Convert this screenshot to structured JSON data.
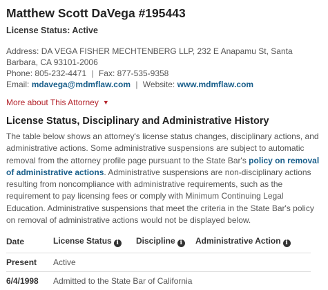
{
  "attorney": {
    "name": "Matthew Scott DaVega #195443",
    "license_status": "License Status: Active"
  },
  "contact": {
    "address_label": "Address:",
    "address_value": "DA VEGA FISHER MECHTENBERG LLP, 232 E Anapamu St, Santa Barbara, CA 93101-2006",
    "phone_label": "Phone:",
    "phone_value": "805-232-4471",
    "separator": "|",
    "fax_label": "Fax:",
    "fax_value": "877-535-9358",
    "email_label": "Email:",
    "email_value": "mdavega@mdmflaw.com",
    "website_label": "Website:",
    "website_value": "www.mdmflaw.com"
  },
  "more_about": {
    "label": "More about This Attorney",
    "icon": "caret-down-icon"
  },
  "history": {
    "title": "License Status, Disciplinary and Administrative History",
    "desc_part1": "The table below shows an attorney's license status changes, disciplinary actions, and administrative actions. Some administrative suspensions are subject to automatic removal from the attorney profile page pursuant to the State Bar's ",
    "desc_link": "policy on removal of administrative actions",
    "desc_part2": ". Administrative suspensions are non-disciplinary actions resulting from noncompliance with administrative requirements, such as the requirement to pay licensing fees or comply with Minimum Continuing Legal Education. Administrative suspensions that meet the criteria in the State Bar's policy on removal of administrative actions would not be displayed below."
  },
  "table": {
    "headers": [
      "Date",
      "License Status",
      "Discipline",
      "Administrative Action"
    ],
    "info_icon": "i",
    "rows": [
      {
        "date": "Present",
        "text": "Active"
      },
      {
        "date": "6/4/1998",
        "text": "Admitted to the State Bar of California"
      }
    ]
  },
  "colors": {
    "link": "#1a5f8b",
    "more_link": "#b3242c",
    "text": "#555555",
    "heading": "#222222"
  }
}
